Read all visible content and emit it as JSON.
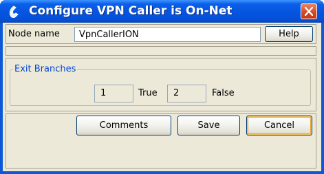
{
  "window": {
    "title": "Configure VPN Caller is On-Net",
    "icon": "phone-handset-icon",
    "close_icon": "close-x-icon"
  },
  "node": {
    "label": "Node name",
    "value": "VpnCallerION",
    "help_label": "Help"
  },
  "exit_branches": {
    "legend": "Exit Branches",
    "true_value": "1",
    "true_label": "True",
    "false_value": "2",
    "false_label": "False"
  },
  "buttons": {
    "comments_label": "Comments",
    "save_label": "Save",
    "cancel_label": "Cancel"
  },
  "colors": {
    "titlebar": "#0554e0",
    "client_bg": "#ece9d8",
    "legend_text": "#0046d5",
    "close_button": "#d44a26"
  }
}
